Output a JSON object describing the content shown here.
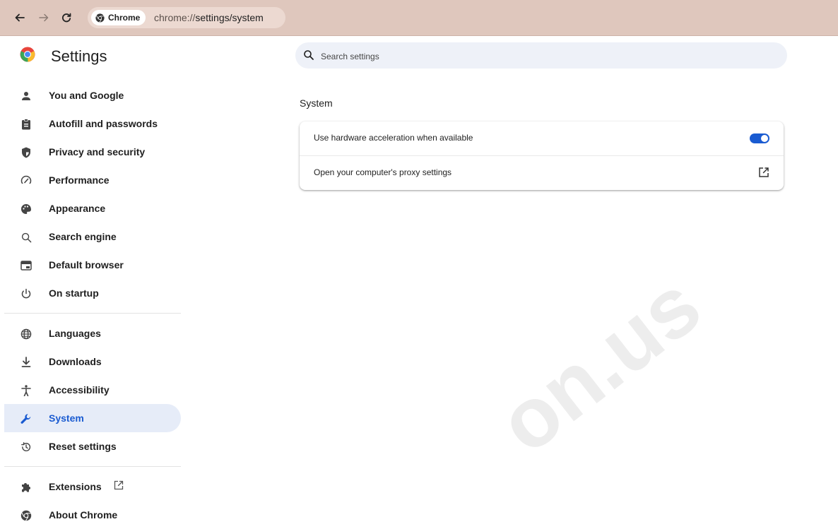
{
  "browser": {
    "chip_label": "Chrome",
    "url_scheme": "chrome://",
    "url_path": "settings/system"
  },
  "header": {
    "title": "Settings"
  },
  "search": {
    "placeholder": "Search settings"
  },
  "sidebar": {
    "items": [
      {
        "label": "You and Google",
        "icon": "person-icon"
      },
      {
        "label": "Autofill and passwords",
        "icon": "clipboard-icon"
      },
      {
        "label": "Privacy and security",
        "icon": "shield-icon"
      },
      {
        "label": "Performance",
        "icon": "speedometer-icon"
      },
      {
        "label": "Appearance",
        "icon": "palette-icon"
      },
      {
        "label": "Search engine",
        "icon": "search-icon"
      },
      {
        "label": "Default browser",
        "icon": "browser-window-icon"
      },
      {
        "label": "On startup",
        "icon": "power-icon"
      },
      {
        "label": "Languages",
        "icon": "globe-icon"
      },
      {
        "label": "Downloads",
        "icon": "download-icon"
      },
      {
        "label": "Accessibility",
        "icon": "accessibility-icon"
      },
      {
        "label": "System",
        "icon": "wrench-icon",
        "active": true
      },
      {
        "label": "Reset settings",
        "icon": "history-icon"
      },
      {
        "label": "Extensions",
        "icon": "puzzle-icon"
      },
      {
        "label": "About Chrome",
        "icon": "chrome-icon"
      }
    ]
  },
  "main": {
    "section_title": "System",
    "rows": [
      {
        "label": "Use hardware acceleration when available",
        "toggle_on": true
      },
      {
        "label": "Open your computer's proxy settings"
      }
    ]
  },
  "watermark": "on.us",
  "colors": {
    "accent": "#1a5bd1",
    "topbar": "#dfc7bd",
    "active_bg": "#e6ecf8",
    "search_bg": "#eef1f8"
  }
}
